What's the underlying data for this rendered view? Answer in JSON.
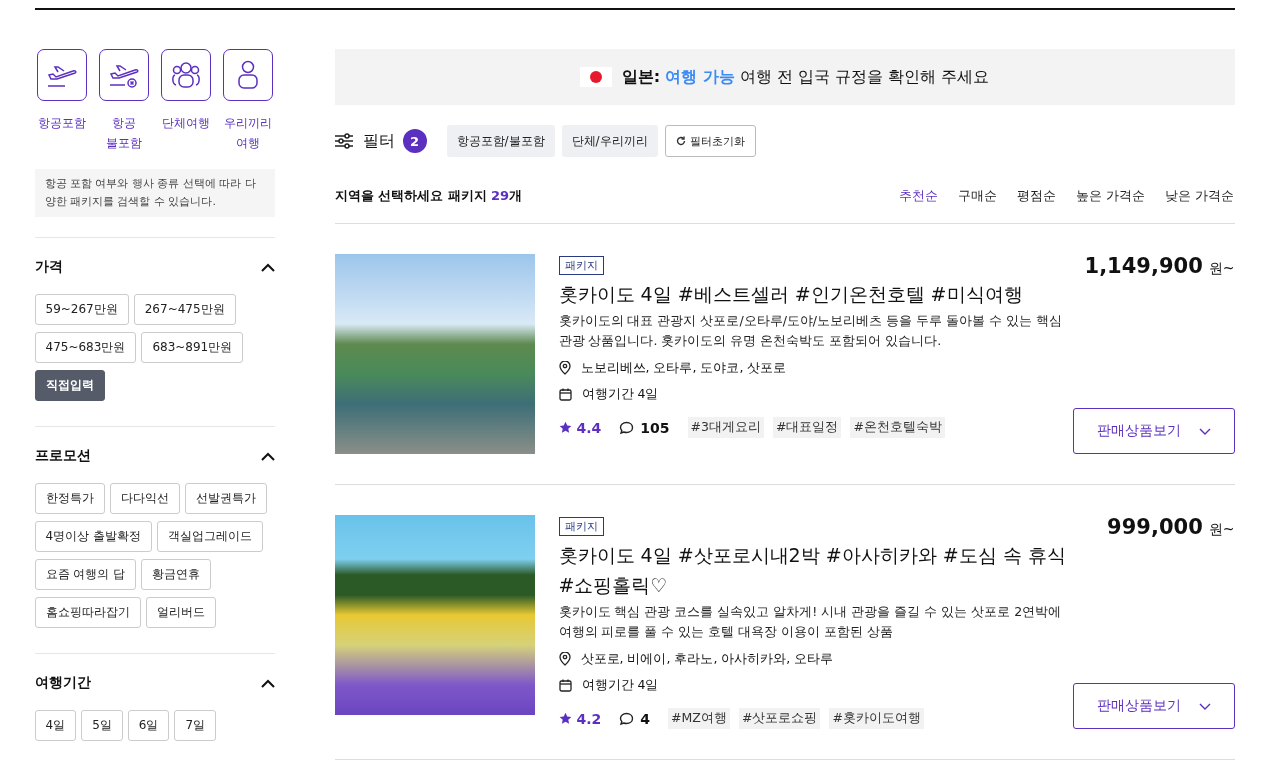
{
  "categories": [
    {
      "label": "항공포함"
    },
    {
      "label": "항공\n불포함"
    },
    {
      "label": "단체여행"
    },
    {
      "label": "우리끼리\n여행"
    }
  ],
  "category_note": "항공 포함 여부와 행사 종류 선택에 따라 다양한 패키지를 검색할 수 있습니다.",
  "filter_sections": [
    {
      "title": "가격",
      "expanded": true,
      "options": [
        {
          "label": "59~267만원",
          "selected": false
        },
        {
          "label": "267~475만원",
          "selected": false
        },
        {
          "label": "475~683만원",
          "selected": false
        },
        {
          "label": "683~891만원",
          "selected": false
        },
        {
          "label": "직접입력",
          "selected": true
        }
      ]
    },
    {
      "title": "프로모션",
      "expanded": true,
      "options": [
        {
          "label": "한정특가",
          "selected": false
        },
        {
          "label": "다다익선",
          "selected": false
        },
        {
          "label": "선발권특가",
          "selected": false
        },
        {
          "label": "4명이상 출발확정",
          "selected": false
        },
        {
          "label": "객실업그레이드",
          "selected": false
        },
        {
          "label": "요즘 여행의 답",
          "selected": false
        },
        {
          "label": "황금연휴",
          "selected": false
        },
        {
          "label": "홈쇼핑따라잡기",
          "selected": false
        },
        {
          "label": "얼리버드",
          "selected": false
        }
      ]
    },
    {
      "title": "여행기간",
      "expanded": true,
      "options": [
        {
          "label": "4일",
          "selected": false
        },
        {
          "label": "5일",
          "selected": false
        },
        {
          "label": "6일",
          "selected": false
        },
        {
          "label": "7일",
          "selected": false
        }
      ]
    }
  ],
  "banner": {
    "country": "일본:",
    "status": "여행 가능",
    "message": "여행 전 입국 규정을 확인해 주세요"
  },
  "filter_bar": {
    "label": "필터",
    "count": "2",
    "chips": [
      "항공포함/불포함",
      "단체/우리끼리"
    ],
    "reset": "필터초기화"
  },
  "results": {
    "title": "지역을 선택하세요 패키지",
    "count": "29",
    "unit": "개"
  },
  "sort_options": [
    {
      "label": "추천순",
      "selected": true
    },
    {
      "label": "구매순",
      "selected": false
    },
    {
      "label": "평점순",
      "selected": false
    },
    {
      "label": "높은 가격순",
      "selected": false
    },
    {
      "label": "낮은 가격순",
      "selected": false
    }
  ],
  "products": [
    {
      "badge": "패키지",
      "title": "홋카이도 4일 #베스트셀러 #인기온천호텔 #미식여행",
      "description": "홋카이도의 대표 관광지 삿포로/오타루/도야/노보리베츠 등을 두루 돌아볼 수 있는 핵심 관광 상품입니다. 홋카이도의 유명 온천숙박도 포함되어 있습니다.",
      "location": "노보리베쓰, 오타루, 도야코, 삿포로",
      "duration": "여행기간 4일",
      "rating": "4.4",
      "reviews": "105",
      "tags": [
        "#3대게요리",
        "#대표일정",
        "#온천호텔숙박"
      ],
      "price": "1,149,900",
      "price_unit": "원~",
      "button": "판매상품보기"
    },
    {
      "badge": "패키지",
      "title": "홋카이도 4일 #삿포로시내2박 #아사히카와 #도심 속 휴식 #쇼핑홀릭♡",
      "description": "홋카이도 핵심 관광 코스를 실속있고 알차게! 시내 관광을 즐길 수 있는 삿포로 2연박에 여행의 피로를 풀 수 있는 호텔 대욕장 이용이 포함된 상품",
      "location": "삿포로, 비에이, 후라노, 아사히카와, 오타루",
      "duration": "여행기간 4일",
      "rating": "4.2",
      "reviews": "4",
      "tags": [
        "#MZ여행",
        "#삿포로쇼핑",
        "#홋카이도여행"
      ],
      "price": "999,000",
      "price_unit": "원~",
      "button": "판매상품보기"
    }
  ]
}
